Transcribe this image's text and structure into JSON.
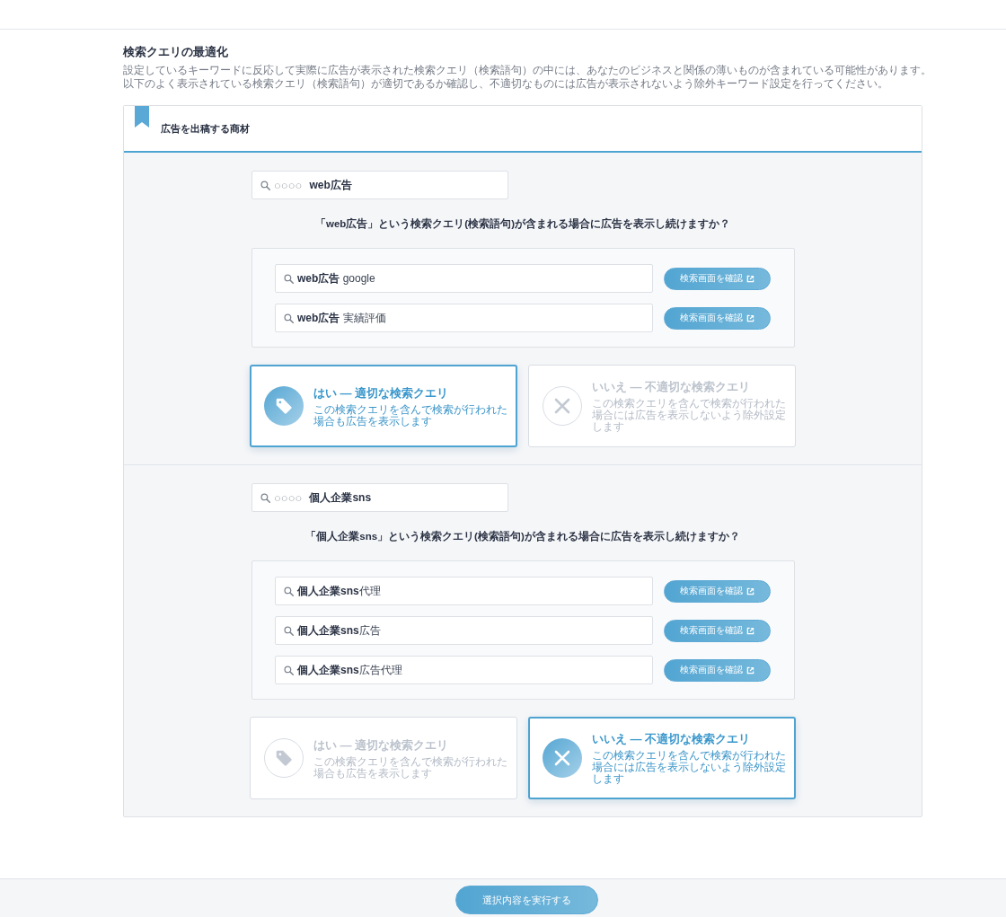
{
  "page": {
    "title": "検索クエリの最適化",
    "description_lines": [
      "設定しているキーワードに反応して実際に広告が表示された検索クエリ（検索語句）の中には、あなたのビジネスと関係の薄いものが含まれている可能性があります。",
      "以下のよく表示されている検索クエリ（検索語句）が適切であるか確認し、不適切なものには広告が表示されないよう除外キーワード設定を行ってください。"
    ]
  },
  "product_section": {
    "title": "広告を出稿する商材",
    "keywords": [
      {
        "search": {
          "prefix": "○○○○",
          "keyword": "web広告"
        },
        "question": "「web広告」という検索クエリ(検索語句)が含まれる場合に広告を表示し続けますか？",
        "queries": [
          {
            "text": "**web広告** google",
            "button": "検索画面を確認"
          },
          {
            "text": "**web広告** 実績評価",
            "button": "検索画面を確認"
          }
        ],
        "choices": [
          {
            "kind": "yes",
            "title": "はい — 適切な検索クエリ",
            "description": "この検索クエリを含んで検索が行われた場合も広告を表示します",
            "selected": true
          },
          {
            "kind": "no",
            "title": "いいえ — 不適切な検索クエリ",
            "description": "この検索クエリを含んで検索が行われた場合には広告を表示しないよう除外設定します",
            "selected": false
          }
        ]
      },
      {
        "search": {
          "prefix": "○○○○",
          "keyword": "個人企業sns"
        },
        "question": "「個人企業sns」という検索クエリ(検索語句)が含まれる場合に広告を表示し続けますか？",
        "queries": [
          {
            "text": "**個人企業sns**代理",
            "button": "検索画面を確認"
          },
          {
            "text": "**個人企業sns**広告",
            "button": "検索画面を確認"
          },
          {
            "text": "**個人企業sns**広告代理",
            "button": "検索画面を確認"
          }
        ],
        "choices": [
          {
            "kind": "yes",
            "title": "はい — 適切な検索クエリ",
            "description": "この検索クエリを含んで検索が行われた場合も広告を表示します",
            "selected": false
          },
          {
            "kind": "no",
            "title": "いいえ — 不適切な検索クエリ",
            "description": "この検索クエリを含んで検索が行われた場合には広告を表示しないよう除外設定します",
            "selected": true
          }
        ]
      }
    ]
  },
  "footer": {
    "submit_button": "選択内容を実行する"
  }
}
